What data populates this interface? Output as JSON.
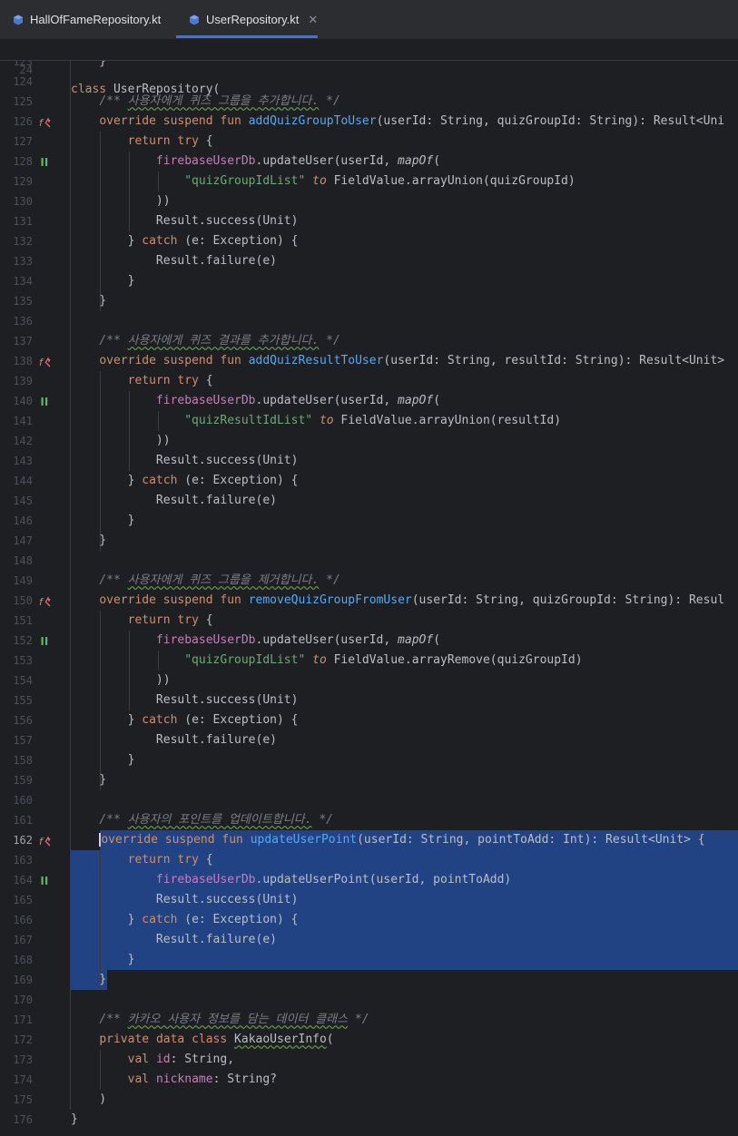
{
  "tabs": [
    {
      "label": "HallOfFameRepository.kt",
      "active": false,
      "icon": "kotlin-file-icon"
    },
    {
      "label": "UserRepository.kt",
      "active": true,
      "icon": "kotlin-file-icon"
    }
  ],
  "sticky_header": {
    "line_number": "24",
    "code": "class UserRepository("
  },
  "colors": {
    "background": "#1e1f22",
    "selection": "#214283",
    "keyword": "#cf8e6d",
    "function": "#56a8f5",
    "string": "#6aab73",
    "comment": "#7a7e85",
    "property": "#c77dbb"
  },
  "lines": [
    {
      "n": "123",
      "code": "    }"
    },
    {
      "n": "124",
      "code": ""
    },
    {
      "n": "125",
      "code": "    /** 사용자에게 퀴즈 그룹을 추가합니다. */"
    },
    {
      "n": "126",
      "code": "    override suspend fun addQuizGroupToUser(userId: String, quizGroupId: String): Result<Uni"
    },
    {
      "n": "127",
      "code": "        return try {"
    },
    {
      "n": "128",
      "code": "            firebaseUserDb.updateUser(userId, mapOf("
    },
    {
      "n": "129",
      "code": "                \"quizGroupIdList\" to FieldValue.arrayUnion(quizGroupId)"
    },
    {
      "n": "130",
      "code": "            ))"
    },
    {
      "n": "131",
      "code": "            Result.success(Unit)"
    },
    {
      "n": "132",
      "code": "        } catch (e: Exception) {"
    },
    {
      "n": "133",
      "code": "            Result.failure(e)"
    },
    {
      "n": "134",
      "code": "        }"
    },
    {
      "n": "135",
      "code": "    }"
    },
    {
      "n": "136",
      "code": ""
    },
    {
      "n": "137",
      "code": "    /** 사용자에게 퀴즈 결과를 추가합니다. */"
    },
    {
      "n": "138",
      "code": "    override suspend fun addQuizResultToUser(userId: String, resultId: String): Result<Unit>"
    },
    {
      "n": "139",
      "code": "        return try {"
    },
    {
      "n": "140",
      "code": "            firebaseUserDb.updateUser(userId, mapOf("
    },
    {
      "n": "141",
      "code": "                \"quizResultIdList\" to FieldValue.arrayUnion(resultId)"
    },
    {
      "n": "142",
      "code": "            ))"
    },
    {
      "n": "143",
      "code": "            Result.success(Unit)"
    },
    {
      "n": "144",
      "code": "        } catch (e: Exception) {"
    },
    {
      "n": "145",
      "code": "            Result.failure(e)"
    },
    {
      "n": "146",
      "code": "        }"
    },
    {
      "n": "147",
      "code": "    }"
    },
    {
      "n": "148",
      "code": ""
    },
    {
      "n": "149",
      "code": "    /** 사용자에게 퀴즈 그룹을 제거합니다. */"
    },
    {
      "n": "150",
      "code": "    override suspend fun removeQuizGroupFromUser(userId: String, quizGroupId: String): Resul"
    },
    {
      "n": "151",
      "code": "        return try {"
    },
    {
      "n": "152",
      "code": "            firebaseUserDb.updateUser(userId, mapOf("
    },
    {
      "n": "153",
      "code": "                \"quizGroupIdList\" to FieldValue.arrayRemove(quizGroupId)"
    },
    {
      "n": "154",
      "code": "            ))"
    },
    {
      "n": "155",
      "code": "            Result.success(Unit)"
    },
    {
      "n": "156",
      "code": "        } catch (e: Exception) {"
    },
    {
      "n": "157",
      "code": "            Result.failure(e)"
    },
    {
      "n": "158",
      "code": "        }"
    },
    {
      "n": "159",
      "code": "    }"
    },
    {
      "n": "160",
      "code": ""
    },
    {
      "n": "161",
      "code": "    /** 사용자의 포인트를 업데이트합니다. */"
    },
    {
      "n": "162",
      "code": "    override suspend fun updateUserPoint(userId: String, pointToAdd: Int): Result<Unit> {"
    },
    {
      "n": "163",
      "code": "        return try {"
    },
    {
      "n": "164",
      "code": "            firebaseUserDb.updateUserPoint(userId, pointToAdd)"
    },
    {
      "n": "165",
      "code": "            Result.success(Unit)"
    },
    {
      "n": "166",
      "code": "        } catch (e: Exception) {"
    },
    {
      "n": "167",
      "code": "            Result.failure(e)"
    },
    {
      "n": "168",
      "code": "        }"
    },
    {
      "n": "169",
      "code": "    }"
    },
    {
      "n": "170",
      "code": ""
    },
    {
      "n": "171",
      "code": "    /** 카카오 사용자 정보를 담는 데이터 클래스 */"
    },
    {
      "n": "172",
      "code": "    private data class KakaoUserInfo("
    },
    {
      "n": "173",
      "code": "        val id: String,"
    },
    {
      "n": "174",
      "code": "        val nickname: String?"
    },
    {
      "n": "175",
      "code": "    )"
    },
    {
      "n": "176",
      "code": "}"
    }
  ],
  "gutter_icons": {
    "126": "override-icon",
    "138": "override-icon",
    "150": "override-icon",
    "162": "override-icon",
    "128": "suspend-call-icon",
    "140": "suspend-call-icon",
    "152": "suspend-call-icon",
    "164": "suspend-call-icon"
  },
  "current_line": "162",
  "selection_lines": [
    "162",
    "163",
    "164",
    "165",
    "166",
    "167",
    "168",
    "169"
  ]
}
